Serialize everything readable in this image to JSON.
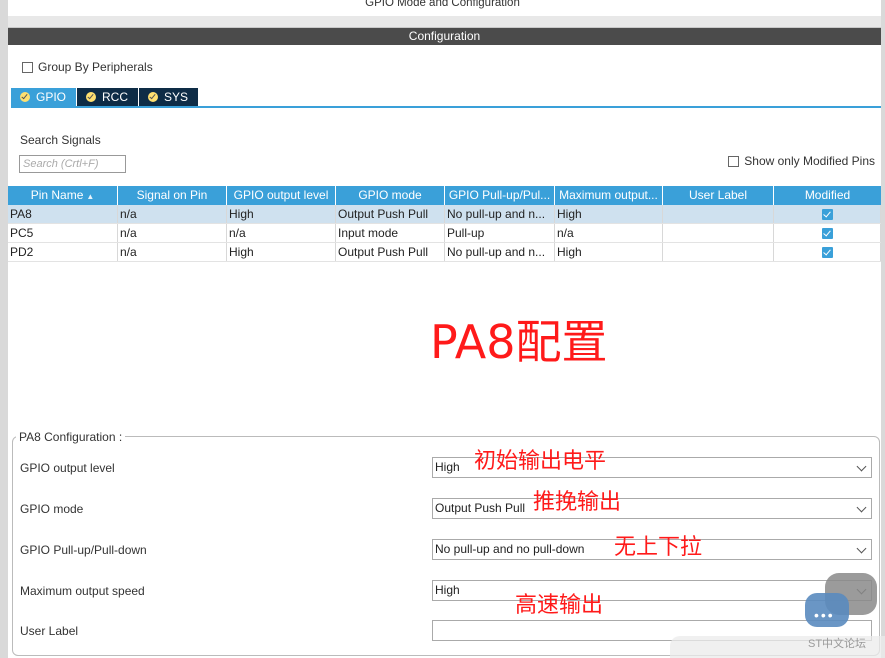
{
  "window": {
    "title": "GPIO Mode and Configuration"
  },
  "config": {
    "header": "Configuration",
    "group_by_label": "Group By Peripherals",
    "group_by_checked": false
  },
  "tabs": [
    {
      "label": "GPIO",
      "active": true
    },
    {
      "label": "RCC",
      "active": false
    },
    {
      "label": "SYS",
      "active": false
    }
  ],
  "search": {
    "label": "Search Signals",
    "placeholder": "Search (Crtl+F)",
    "show_modified_label": "Show only Modified Pins",
    "show_modified_checked": false
  },
  "table": {
    "columns": [
      "Pin Name",
      "Signal on Pin",
      "GPIO output level",
      "GPIO mode",
      "GPIO Pull-up/Pul...",
      "Maximum output...",
      "User Label",
      "Modified"
    ],
    "rows": [
      {
        "pin": "PA8",
        "signal": "n/a",
        "level": "High",
        "mode": "Output Push Pull",
        "pull": "No pull-up and n...",
        "speed": "High",
        "label": "",
        "modified": true,
        "selected": true
      },
      {
        "pin": "PC5",
        "signal": "n/a",
        "level": "n/a",
        "mode": "Input mode",
        "pull": "Pull-up",
        "speed": "n/a",
        "label": "",
        "modified": true,
        "selected": false
      },
      {
        "pin": "PD2",
        "signal": "n/a",
        "level": "High",
        "mode": "Output Push Pull",
        "pull": "No pull-up and n...",
        "speed": "High",
        "label": "",
        "modified": true,
        "selected": false
      }
    ]
  },
  "annotation_main": "PA8配置",
  "pin_config": {
    "legend": "PA8 Configuration :",
    "fields": [
      {
        "label": "GPIO output level",
        "value": "High",
        "annotation": "初始输出电平"
      },
      {
        "label": "GPIO mode",
        "value": "Output Push Pull",
        "annotation": "推挽输出"
      },
      {
        "label": "GPIO Pull-up/Pull-down",
        "value": "No pull-up and no pull-down",
        "annotation": "无上下拉"
      },
      {
        "label": "Maximum output speed",
        "value": "High",
        "annotation": "高速输出"
      },
      {
        "label": "User Label",
        "value": ""
      }
    ]
  },
  "watermark": {
    "text": "ST中文论坛",
    "dots": "•••"
  },
  "colors": {
    "accent": "#3aa0d9",
    "tab_dark": "#0e2c46",
    "header_dark": "#4b4b4b",
    "annotation_red": "#ff1a1a"
  }
}
